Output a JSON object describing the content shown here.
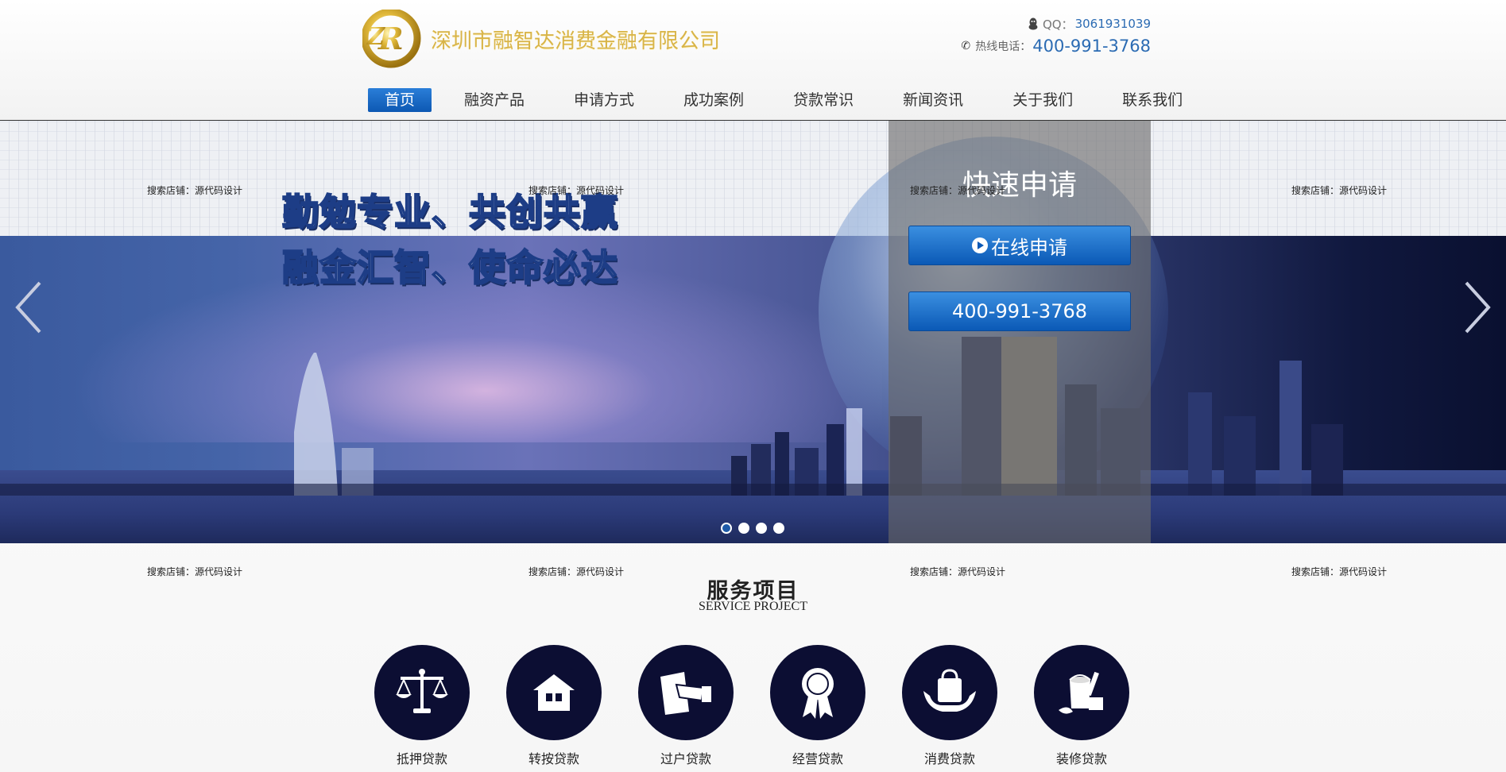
{
  "header": {
    "company_name": "深圳市融智达消费金融有限公司",
    "qq_label": "QQ：",
    "qq_number": "3061931039",
    "hotline_label": "热线电话：",
    "hotline_number": "400-991-3768"
  },
  "nav": {
    "items": [
      {
        "label": "首页",
        "active": true
      },
      {
        "label": "融资产品"
      },
      {
        "label": "申请方式"
      },
      {
        "label": "成功案例"
      },
      {
        "label": "贷款常识"
      },
      {
        "label": "新闻资讯"
      },
      {
        "label": "关于我们"
      },
      {
        "label": "联系我们"
      }
    ]
  },
  "banner": {
    "slogan_line1": "勤勉专业、共创共赢",
    "slogan_line2": "融金汇智、使命必达",
    "slide_count": 4,
    "active_slide": 1
  },
  "apply": {
    "title": "快速申请",
    "online_label": "在线申请",
    "phone_label": "400-991-3768"
  },
  "watermark": "搜索店铺：源代码设计",
  "services": {
    "title": "服务项目",
    "subtitle": "SERVICE PROJECT",
    "items": [
      {
        "label": "抵押贷款",
        "icon": "scales-icon"
      },
      {
        "label": "转按贷款",
        "icon": "house-icon"
      },
      {
        "label": "过户贷款",
        "icon": "document-handover-icon"
      },
      {
        "label": "经营贷款",
        "icon": "award-ribbon-icon"
      },
      {
        "label": "消费贷款",
        "icon": "shopping-bag-hands-icon"
      },
      {
        "label": "装修贷款",
        "icon": "paint-bucket-icon"
      }
    ]
  },
  "colors": {
    "brand_blue": "#0d58b3",
    "logo_gold": "#d8b448",
    "service_circle": "#0c0e33"
  }
}
